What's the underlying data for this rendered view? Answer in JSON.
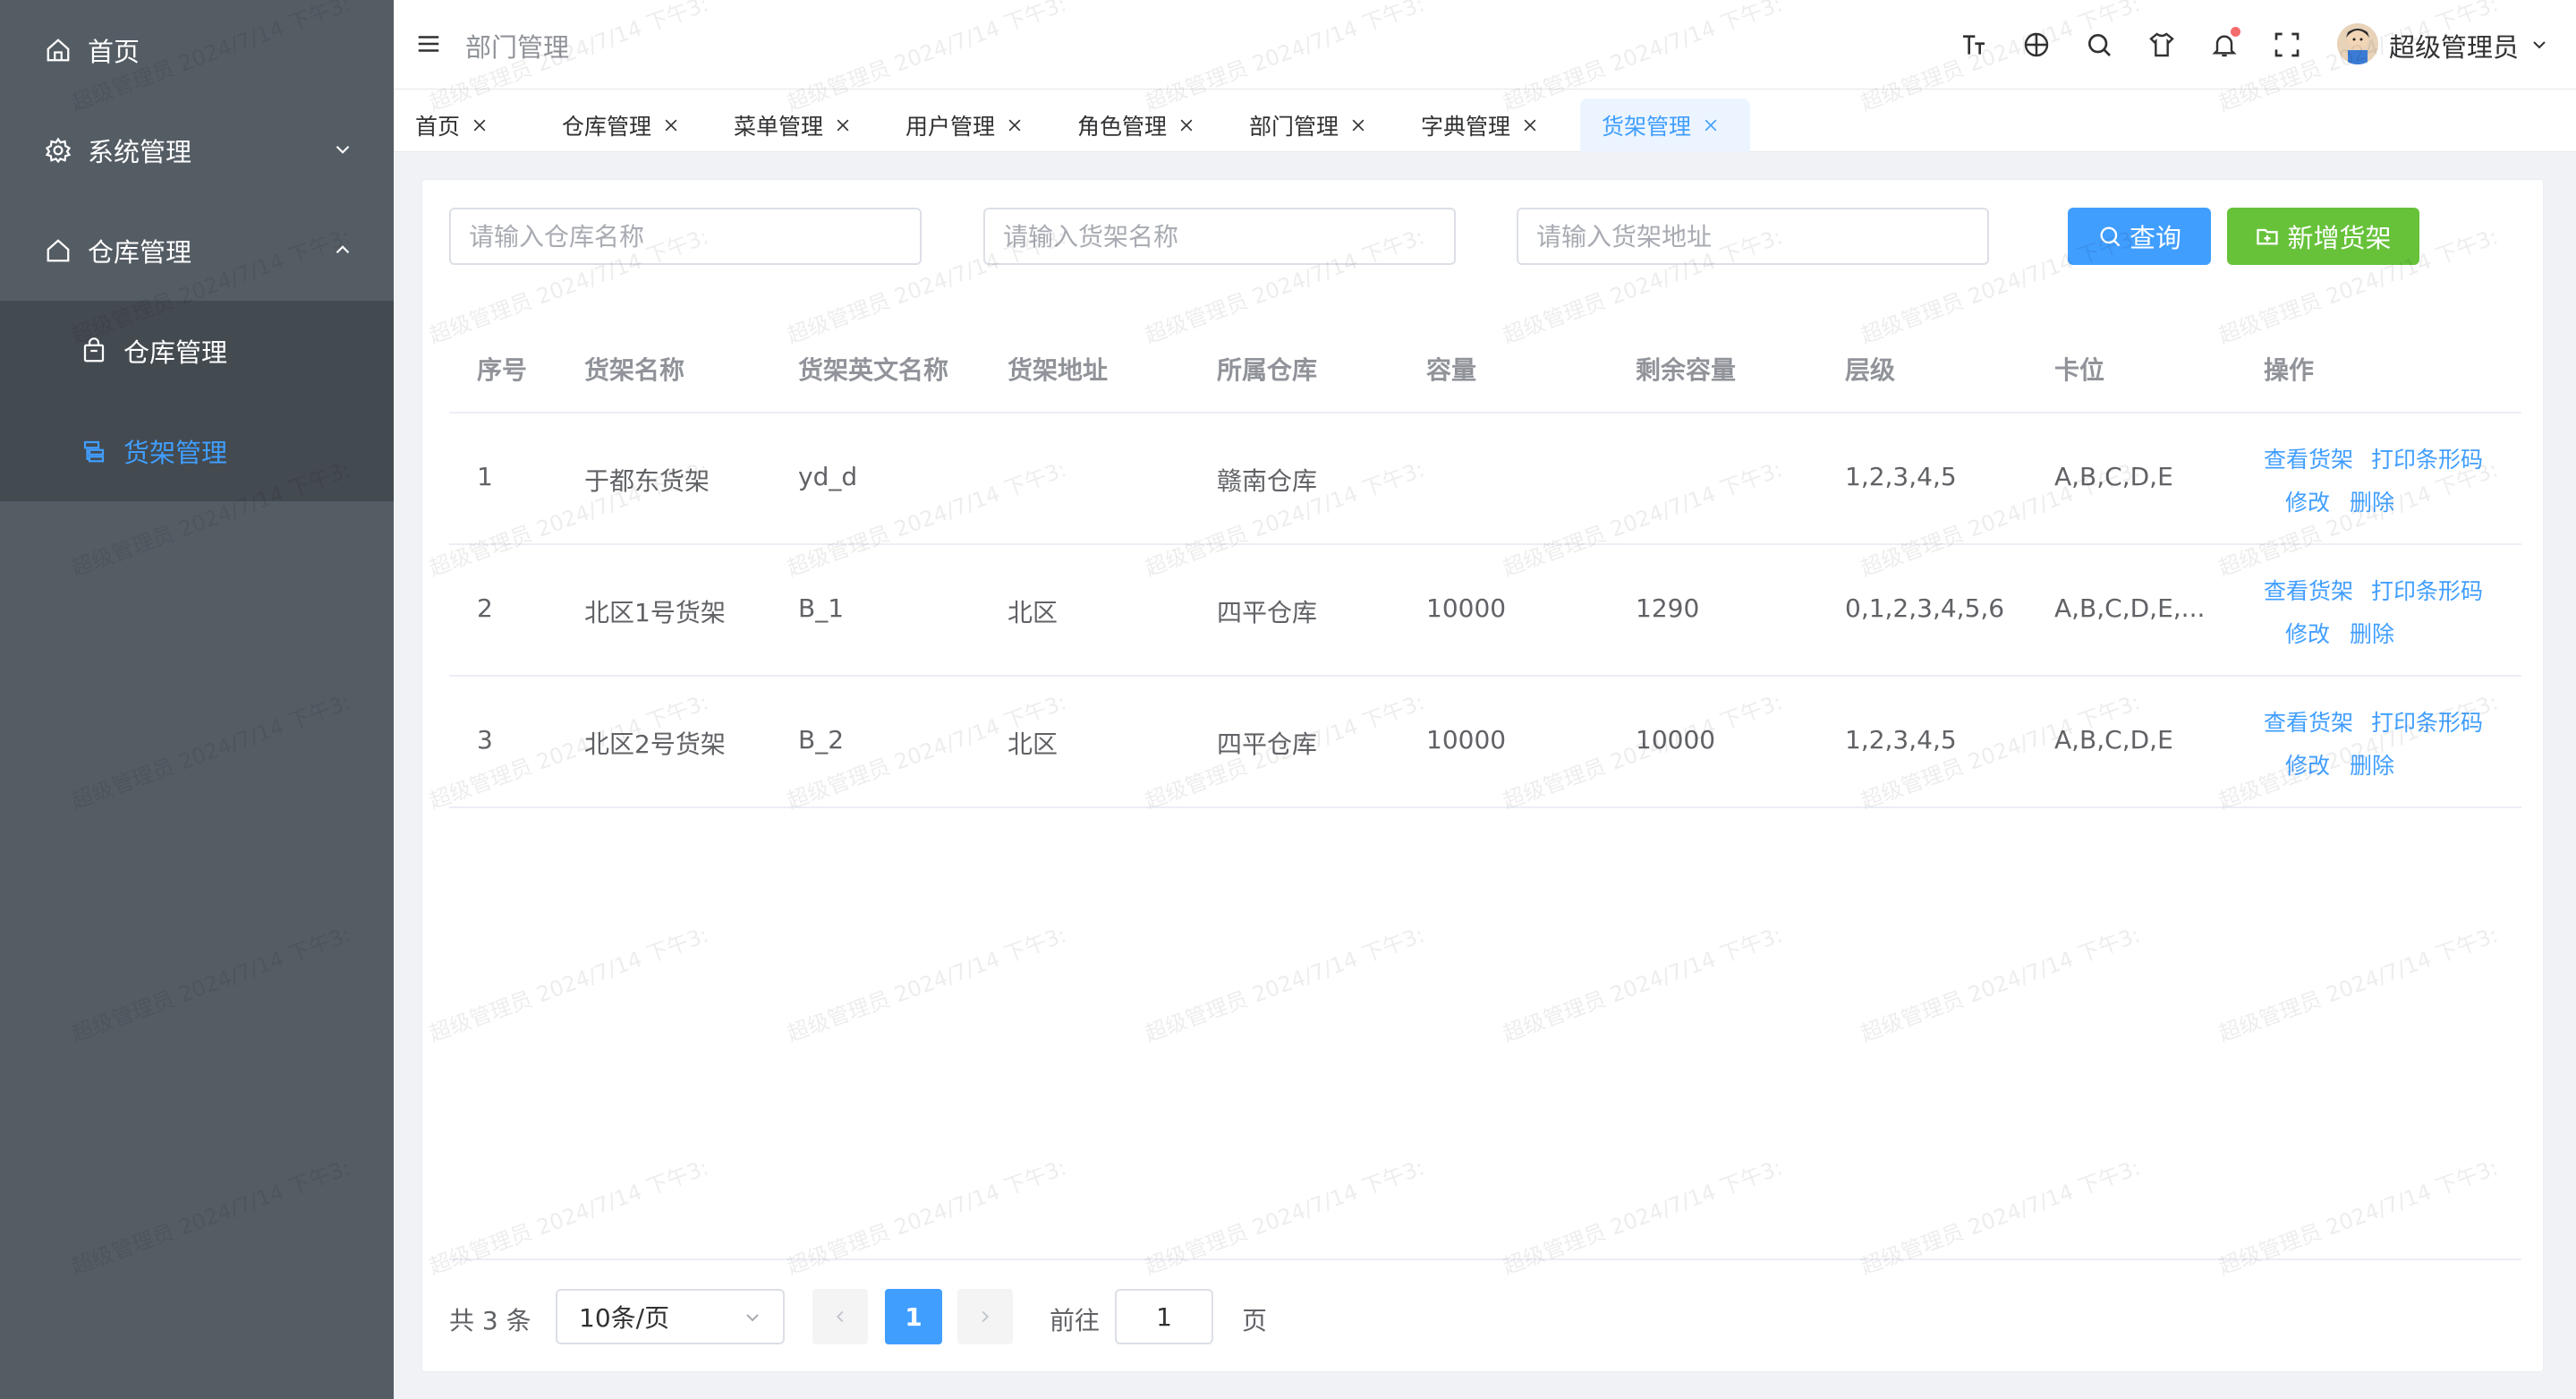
{
  "sidebar": {
    "items": [
      {
        "label": "首页",
        "icon": "home-icon"
      },
      {
        "label": "系统管理",
        "icon": "gear-icon"
      },
      {
        "label": "仓库管理",
        "icon": "home-icon"
      }
    ],
    "submenu": [
      {
        "label": "仓库管理",
        "icon": "shopping-bag-icon"
      },
      {
        "label": "货架管理",
        "icon": "list-icon"
      }
    ]
  },
  "header": {
    "breadcrumb": "部门管理",
    "username": "超级管理员"
  },
  "tabs": [
    {
      "label": "首页"
    },
    {
      "label": "仓库管理"
    },
    {
      "label": "菜单管理"
    },
    {
      "label": "用户管理"
    },
    {
      "label": "角色管理"
    },
    {
      "label": "部门管理"
    },
    {
      "label": "字典管理"
    },
    {
      "label": "货架管理"
    }
  ],
  "search": {
    "warehouse_placeholder": "请输入仓库名称",
    "shelf_placeholder": "请输入货架名称",
    "address_placeholder": "请输入货架地址",
    "query_label": "查询",
    "add_label": "新增货架"
  },
  "table": {
    "columns": [
      "序号",
      "货架名称",
      "货架英文名称",
      "货架地址",
      "所属仓库",
      "容量",
      "剩余容量",
      "层级",
      "卡位",
      "操作"
    ],
    "rows": [
      {
        "index": "1",
        "name": "于都东货架",
        "en_name": "yd_d",
        "address": "",
        "warehouse": "赣南仓库",
        "capacity": "",
        "remaining": "",
        "levels": "1,2,3,4,5",
        "slots": "A,B,C,D,E"
      },
      {
        "index": "2",
        "name": "北区1号货架",
        "en_name": "B_1",
        "address": "北区",
        "warehouse": "四平仓库",
        "capacity": "10000",
        "remaining": "1290",
        "levels": "0,1,2,3,4,5,6",
        "slots": "A,B,C,D,E,..."
      },
      {
        "index": "3",
        "name": "北区2号货架",
        "en_name": "B_2",
        "address": "北区",
        "warehouse": "四平仓库",
        "capacity": "10000",
        "remaining": "10000",
        "levels": "1,2,3,4,5",
        "slots": "A,B,C,D,E"
      }
    ],
    "actions": {
      "view": "查看货架",
      "print": "打印条形码",
      "edit": "修改",
      "delete": "删除"
    }
  },
  "pagination": {
    "total": "共 3 条",
    "page_size": "10条/页",
    "current_page": "1",
    "goto_label": "前往",
    "goto_value": "1",
    "page_suffix": "页"
  },
  "watermark": "超级管理员 2024/7/14 下午3:",
  "colors": {
    "primary": "#409eff",
    "success": "#67c23a",
    "sidebar": "#545c64",
    "sidebar_sub": "#434a50"
  }
}
